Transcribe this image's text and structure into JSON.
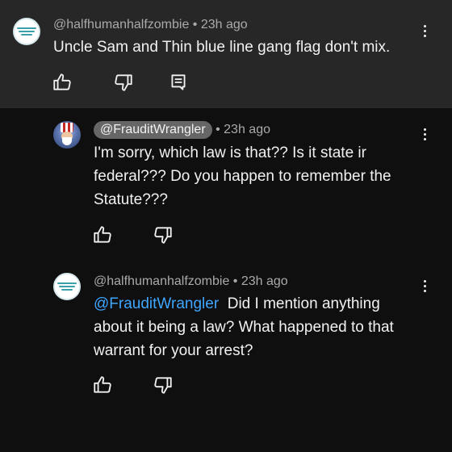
{
  "comments": [
    {
      "author": "@halfhumanhalfzombie",
      "time": "• 23h ago",
      "text": "Uncle Sam and Thin blue line gang flag don't mix."
    },
    {
      "author": "@FrauditWrangler",
      "time": "• 23h ago",
      "text": "I'm sorry, which law is that?? Is it state ir federal??? Do you happen to remember the Statute???"
    },
    {
      "author": "@halfhumanhalfzombie",
      "time": "• 23h ago",
      "mention": "@FrauditWrangler",
      "text": "Did I mention anything about it being a law? What happened to that warrant for your arrest?"
    }
  ],
  "icons": {
    "like": "thumbs-up-icon",
    "dislike": "thumbs-down-icon",
    "reply": "comment-icon",
    "menu": "more-vert-icon"
  },
  "colors": {
    "background": "#0f0f0f",
    "highlight_background": "#272727",
    "text": "#f1f1f1",
    "meta": "#aaaaaa",
    "mention": "#3ea6ff",
    "handle_pill": "#666666"
  }
}
